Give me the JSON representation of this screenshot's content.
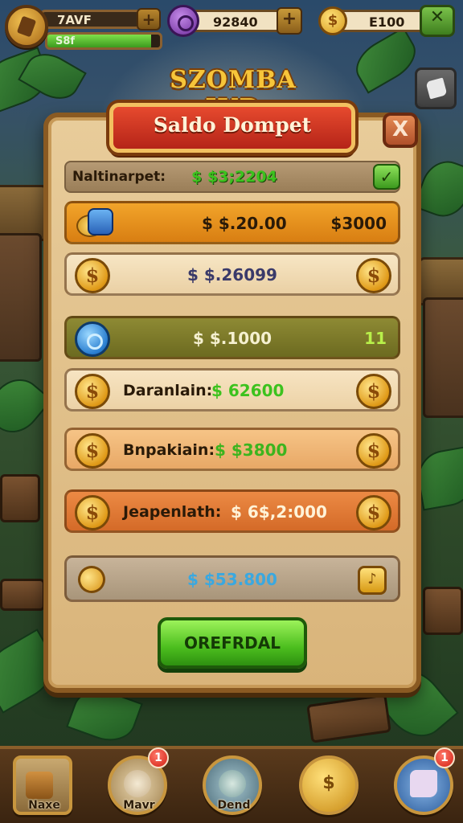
{
  "hud": {
    "level_label": "7AVF",
    "xp_label": "S8f",
    "xp_fill_fraction": 0.92,
    "gems_value": "92840",
    "coins_value": "E100"
  },
  "logo": {
    "text": "SZOMBA IUD"
  },
  "dialog": {
    "title": "Saldo Dompet",
    "close_symbol": "X",
    "summary": {
      "label": "Naltinarpet:",
      "value": "$ $3;2204",
      "confirm_symbol": "✓"
    },
    "rows": [
      {
        "label": "",
        "value": "$ $.20.00",
        "value_right": "$3000"
      },
      {
        "label": "",
        "value": "$ $.26099",
        "value_right": ""
      },
      {
        "label": "",
        "value": "$ $.1000",
        "value_right": "11"
      },
      {
        "label": "Daranlain:",
        "value": "$ 62600",
        "value_right": ""
      },
      {
        "label": "Bnpakiain:",
        "value": "$ $3800",
        "value_right": ""
      },
      {
        "label": "Jeapenlath:",
        "value": "$ 6$,2:000",
        "value_right": ""
      },
      {
        "label": "",
        "value": "$ $53.800",
        "value_right": ""
      }
    ],
    "primary_button": "OREFRDAL"
  },
  "bottom_nav": {
    "items": [
      {
        "label": "Naxe",
        "badge": ""
      },
      {
        "label": "Mavr",
        "badge": "1"
      },
      {
        "label": "Dend",
        "badge": ""
      },
      {
        "label": "",
        "badge": ""
      },
      {
        "label": "",
        "badge": "1"
      }
    ]
  },
  "colors": {
    "panel": "#e8cc9a",
    "title_red": "#e64a2e",
    "confirm_green": "#4cbe1e",
    "value_green": "#3cc21e",
    "value_dark": "#2a1a08"
  }
}
